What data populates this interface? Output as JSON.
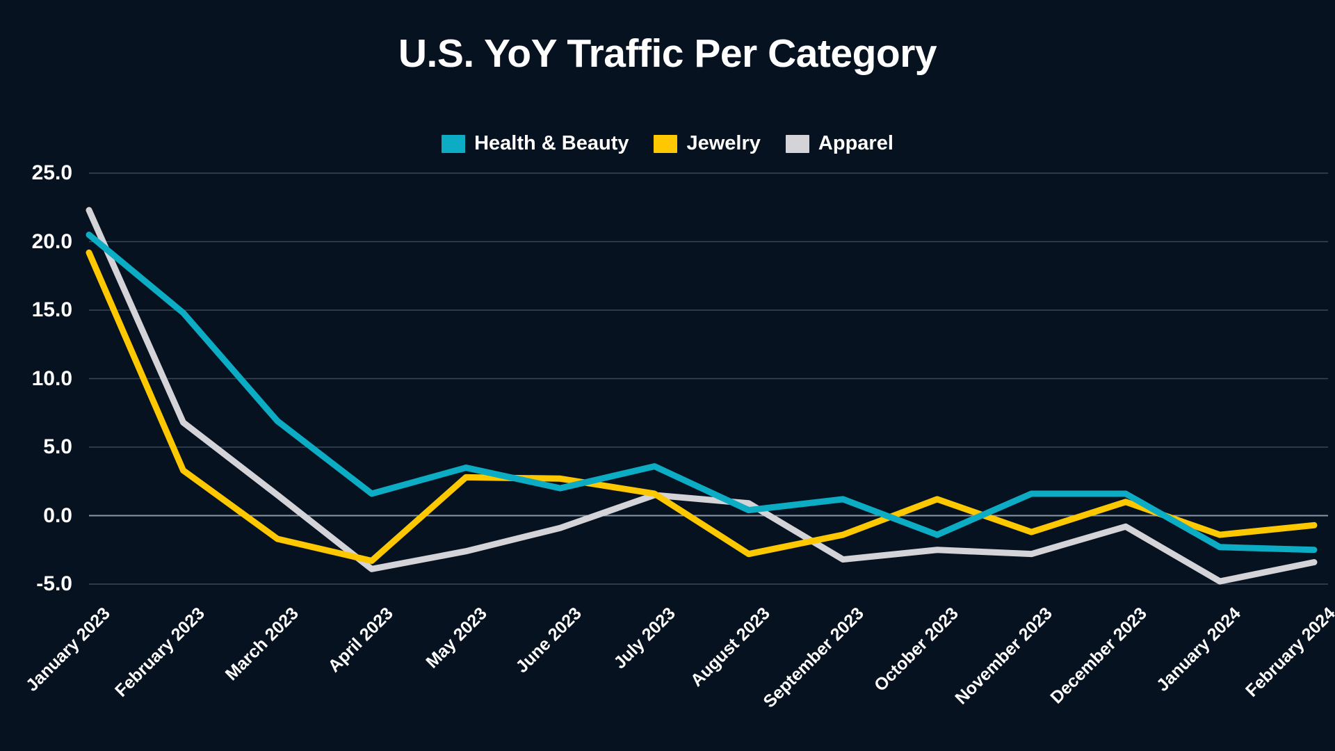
{
  "background_color": "#06121f",
  "title": "U.S. YoY Traffic Per Category",
  "legend": {
    "position": "top-center",
    "items": [
      {
        "label": "Health & Beauty",
        "color": "#0bacc4"
      },
      {
        "label": "Jewelry",
        "color": "#fdc800"
      },
      {
        "label": "Apparel",
        "color": "#d4d4d8"
      }
    ]
  },
  "axes": {
    "y_tick_labels": [
      "25.0",
      "20.0",
      "15.0",
      "10.0",
      "5.0",
      "0.0",
      "-5.0"
    ],
    "x_tick_labels": [
      "January 2023",
      "February 2023",
      "March 2023",
      "April 2023",
      "May 2023",
      "June 2023",
      "July 2023",
      "August 2023",
      "September 2023",
      "October 2023",
      "November 2023",
      "December 2023",
      "January 2024",
      "February 2024"
    ]
  },
  "chart_data": {
    "type": "line",
    "title": "U.S. YoY Traffic Per Category",
    "xlabel": "",
    "ylabel": "",
    "ylim": [
      -6.5,
      25.0
    ],
    "yticks": [
      25.0,
      20.0,
      15.0,
      10.0,
      5.0,
      0.0,
      -5.0
    ],
    "grid": true,
    "legend_position": "top-center",
    "categories": [
      "January 2023",
      "February 2023",
      "March 2023",
      "April 2023",
      "May 2023",
      "June 2023",
      "July 2023",
      "August 2023",
      "September 2023",
      "October 2023",
      "November 2023",
      "December 2023",
      "January 2024",
      "February 2024"
    ],
    "series": [
      {
        "name": "Health & Beauty",
        "color": "#0bacc4",
        "values": [
          20.5,
          14.8,
          6.9,
          1.6,
          3.5,
          2.0,
          3.6,
          0.4,
          1.2,
          -1.4,
          1.6,
          1.6,
          -2.3,
          -2.5
        ]
      },
      {
        "name": "Jewelry",
        "color": "#fdc800",
        "values": [
          19.2,
          3.3,
          -1.7,
          -3.3,
          2.8,
          2.7,
          1.6,
          -2.8,
          -1.4,
          1.2,
          -1.2,
          1.0,
          -1.4,
          -0.7
        ]
      },
      {
        "name": "Apparel",
        "color": "#d4d4d8",
        "values": [
          22.3,
          6.8,
          1.5,
          -3.9,
          -2.6,
          -0.9,
          1.5,
          0.9,
          -3.2,
          -2.5,
          -2.8,
          -0.8,
          -4.8,
          -3.4
        ]
      }
    ]
  }
}
